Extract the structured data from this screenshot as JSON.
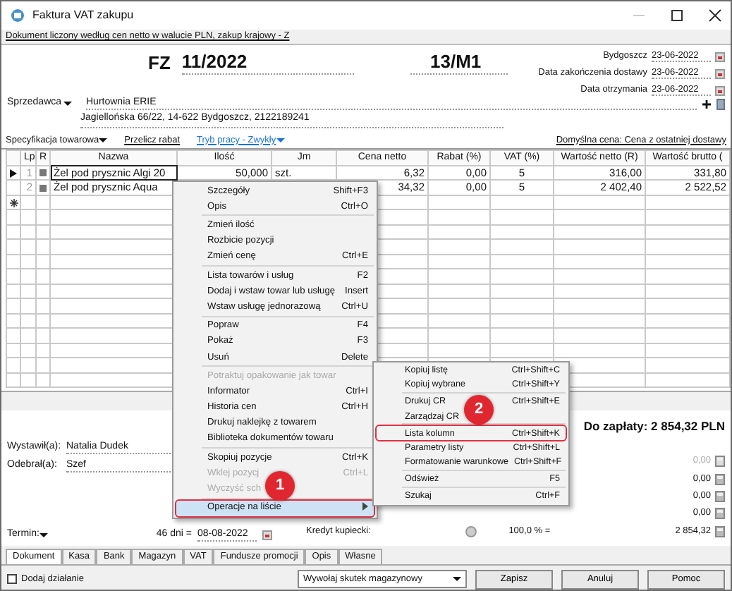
{
  "window": {
    "title": "Faktura VAT zakupu"
  },
  "doc_info": "Dokument liczony według cen netto w walucie PLN, zakup krajowy - Z",
  "header": {
    "prefix": "FZ",
    "number": "11/2022",
    "series": "13/M1",
    "dates": [
      {
        "label": "Bydgoszcz",
        "value": "23-06-2022"
      },
      {
        "label": "Data zakończenia dostawy",
        "value": "23-06-2022"
      },
      {
        "label": "Data otrzymania",
        "value": "23-06-2022"
      }
    ]
  },
  "seller": {
    "label": "Sprzedawca",
    "name": "Hurtownia ERIE",
    "address": "Jagiellońska  66/22, 14-622 Bydgoszcz, 2122189241"
  },
  "toolbar": {
    "spec": "Specyfikacja towarowa",
    "recalc": "Przelicz rabat",
    "mode": "Tryb pracy - Zwykły",
    "default_price": "Domyślna cena: Cena z ostatniej dostawy"
  },
  "table": {
    "columns": [
      "Lp",
      "R",
      "Nazwa",
      "Ilość",
      "Jm",
      "Cena netto",
      "Rabat (%)",
      "VAT (%)",
      "Wartość netto (R)",
      "Wartość brutto ("
    ],
    "rows": [
      {
        "current": true,
        "lp": "1",
        "name": "Żel pod prysznic Algi 20",
        "qty": "50,000",
        "unit": "szt.",
        "price": "6,32",
        "discount": "0,00",
        "vat": "5",
        "net": "316,00",
        "gross": "331,80"
      },
      {
        "current": false,
        "lp": "2",
        "name": "Żel pod prysznic Aqua",
        "price": "34,32",
        "discount": "0,00",
        "vat": "5",
        "net": "2 402,40",
        "gross": "2 522,52"
      }
    ]
  },
  "footer": {
    "issued_by": {
      "label": "Wystawił(a):",
      "value": "Natalia Dudek"
    },
    "received_by": {
      "label": "Odebrał(a):",
      "value": "Szef"
    },
    "total": "Do zapłaty: 2 854,32 PLN",
    "amounts": [
      {
        "value": "0,00",
        "disabled": true
      },
      {
        "value": "0,00",
        "disabled": false
      },
      {
        "value": "0,00",
        "disabled": false
      },
      {
        "value": "0,00",
        "disabled": false
      }
    ],
    "credit": {
      "label": "Kredyt kupiecki:",
      "percent": "100,0 % =",
      "value": "2 854,32"
    },
    "term": {
      "label": "Termin:",
      "days": "46 dni =",
      "date": "08-08-2022"
    }
  },
  "tabs": [
    {
      "label": "Dokument",
      "selected": true
    },
    {
      "label": "Kasa",
      "selected": false
    },
    {
      "label": "Bank",
      "selected": false
    },
    {
      "label": "Magazyn",
      "selected": false
    },
    {
      "label": "VAT",
      "selected": false
    },
    {
      "label": "Fundusze promocji",
      "selected": false
    },
    {
      "label": "Opis",
      "selected": false
    },
    {
      "label": "Własne",
      "selected": false
    }
  ],
  "action_checkbox": {
    "label": "Dodaj działanie",
    "checked": false
  },
  "effect_dropdown": {
    "value": "Wywołaj skutek magazynowy"
  },
  "buttons": [
    "Zapisz",
    "Anuluj",
    "Pomoc"
  ],
  "context_menu": [
    {
      "kind": "item",
      "label": "Szczegóły",
      "shortcut": "Shift+F3"
    },
    {
      "kind": "item",
      "label": "Opis",
      "shortcut": "Ctrl+O"
    },
    {
      "kind": "separator"
    },
    {
      "kind": "item",
      "label": "Zmień ilość"
    },
    {
      "kind": "item",
      "label": "Rozbicie pozycji"
    },
    {
      "kind": "item",
      "label": "Zmień cenę",
      "shortcut": "Ctrl+E"
    },
    {
      "kind": "separator"
    },
    {
      "kind": "item",
      "label": "Lista towarów i usług",
      "shortcut": "F2"
    },
    {
      "kind": "item",
      "label": "Dodaj i wstaw towar lub usługę",
      "shortcut": "Insert"
    },
    {
      "kind": "item",
      "label": "Wstaw usługę jednorazową",
      "shortcut": "Ctrl+U"
    },
    {
      "kind": "separator"
    },
    {
      "kind": "item",
      "label": "Popraw",
      "shortcut": "F4"
    },
    {
      "kind": "item",
      "label": "Pokaż",
      "shortcut": "F3"
    },
    {
      "kind": "item",
      "label": "Usuń",
      "shortcut": "Delete"
    },
    {
      "kind": "separator"
    },
    {
      "kind": "item",
      "label": "Potraktuj opakowanie jak towar",
      "disabled": true
    },
    {
      "kind": "item",
      "label": "Informator",
      "shortcut": "Ctrl+I"
    },
    {
      "kind": "item",
      "label": "Historia cen",
      "shortcut": "Ctrl+H"
    },
    {
      "kind": "item",
      "label": "Drukuj naklejkę z towarem"
    },
    {
      "kind": "item",
      "label": "Biblioteka dokumentów towaru"
    },
    {
      "kind": "separator"
    },
    {
      "kind": "item",
      "label": "Skopiuj pozycje",
      "shortcut": "Ctrl+K"
    },
    {
      "kind": "item",
      "label": "Wklej pozycj",
      "shortcut": "Ctrl+L",
      "disabled": true
    },
    {
      "kind": "item",
      "label": "Wyczyść sch",
      "disabled": true
    },
    {
      "kind": "separator"
    },
    {
      "kind": "item",
      "label": "Operacje na liście",
      "submenu": true,
      "highlighted": true,
      "outlined": true
    }
  ],
  "submenu": [
    {
      "kind": "item",
      "label": "Kopiuj listę",
      "shortcut": "Ctrl+Shift+C"
    },
    {
      "kind": "item",
      "label": "Kopiuj wybrane",
      "shortcut": "Ctrl+Shift+Y"
    },
    {
      "kind": "separator"
    },
    {
      "kind": "item",
      "label": "Drukuj CR",
      "shortcut": "Ctrl+Shift+E"
    },
    {
      "kind": "item",
      "label": "Zarządzaj CR"
    },
    {
      "kind": "separator"
    },
    {
      "kind": "item",
      "label": "Lista kolumn",
      "shortcut": "Ctrl+Shift+K",
      "outlined": true
    },
    {
      "kind": "item",
      "label": "Parametry listy",
      "shortcut": "Ctrl+Shift+L"
    },
    {
      "kind": "item",
      "label": "Formatowanie warunkowe",
      "shortcut": "Ctrl+Shift+F"
    },
    {
      "kind": "separator"
    },
    {
      "kind": "item",
      "label": "Odśwież",
      "shortcut": "F5"
    },
    {
      "kind": "separator"
    },
    {
      "kind": "item",
      "label": "Szukaj",
      "shortcut": "Ctrl+F"
    }
  ],
  "badges": [
    "1",
    "2"
  ]
}
